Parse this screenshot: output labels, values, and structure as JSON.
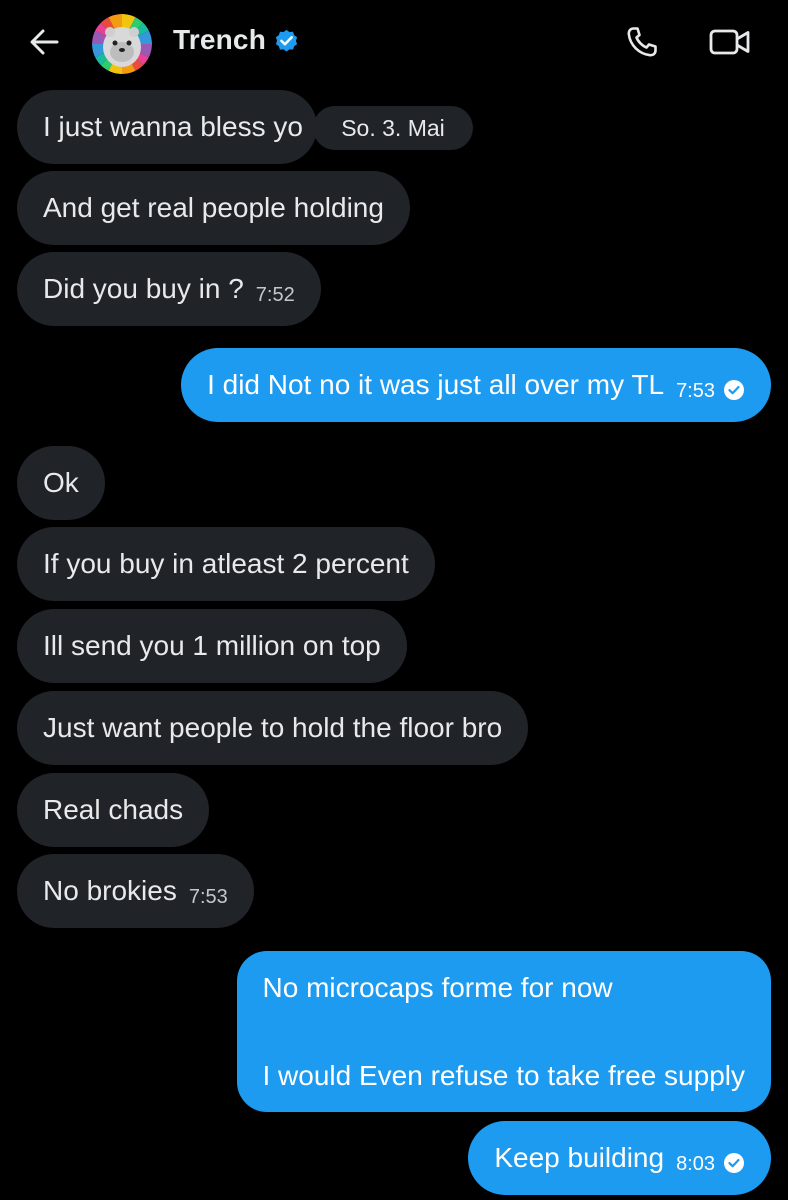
{
  "header": {
    "back_icon": "arrow-left-icon",
    "contact_name": "Trench",
    "verified_icon": "verified-badge-icon",
    "call_icon": "phone-icon",
    "video_icon": "video-camera-icon",
    "accent": "#1d9bf0"
  },
  "date_separator": "So. 3. Mai",
  "messages": [
    {
      "dir": "in",
      "text": "I just wanna bless yo"
    },
    {
      "dir": "in",
      "text": "And get real people holding"
    },
    {
      "dir": "in",
      "text": "Did you buy in ?",
      "time": "7:52"
    },
    {
      "dir": "out",
      "text": "I did Not no it was just all over my TL",
      "time": "7:53",
      "read": true
    },
    {
      "dir": "in",
      "text": "Ok"
    },
    {
      "dir": "in",
      "text": "If you buy in atleast 2 percent"
    },
    {
      "dir": "in",
      "text": "Ill send you 1 million on top"
    },
    {
      "dir": "in",
      "text": "Just want people to hold the floor bro"
    },
    {
      "dir": "in",
      "text": "Real chads"
    },
    {
      "dir": "in",
      "text": "No brokies",
      "time": "7:53"
    },
    {
      "dir": "out",
      "lines": [
        "No microcaps forme for now",
        "I would Even refuse to take free supply"
      ]
    },
    {
      "dir": "out",
      "text": "Keep building",
      "time": "8:03",
      "read": true
    }
  ],
  "colors": {
    "background": "#000000",
    "incoming_bubble": "#202327",
    "outgoing_bubble": "#1d9bf0",
    "text": "#e7e9ea"
  }
}
